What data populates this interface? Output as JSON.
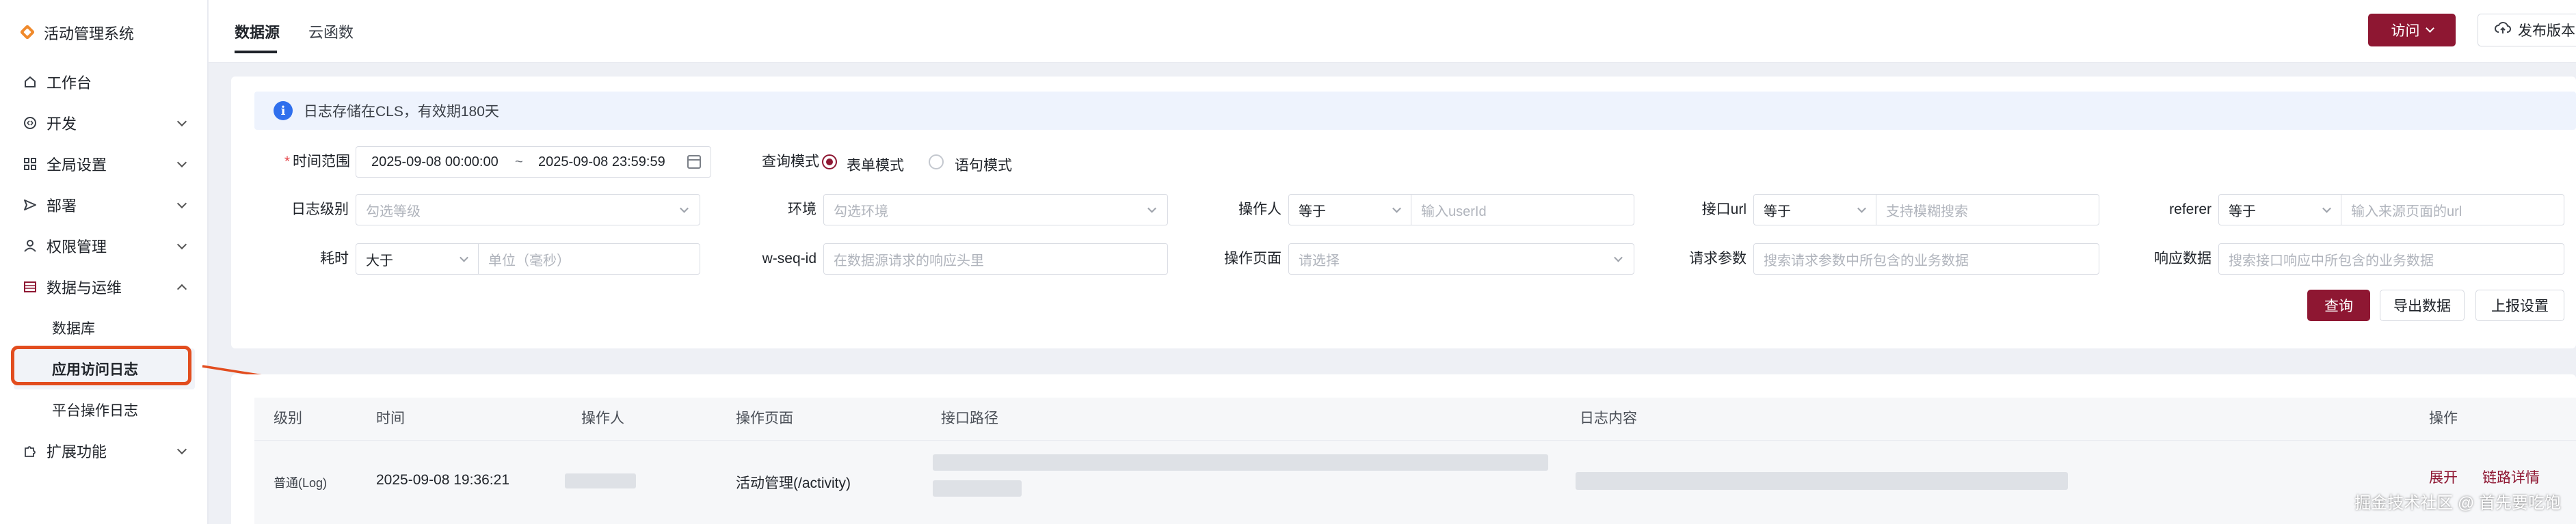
{
  "sidebar": {
    "app_title": "活动管理系统",
    "items": [
      {
        "label": "工作台",
        "icon": "home-icon"
      },
      {
        "label": "开发",
        "icon": "code-icon"
      },
      {
        "label": "全局设置",
        "icon": "grid-icon"
      },
      {
        "label": "部署",
        "icon": "send-icon"
      },
      {
        "label": "权限管理",
        "icon": "user-icon"
      },
      {
        "label": "数据与运维",
        "icon": "database-icon"
      },
      {
        "label": "扩展功能",
        "icon": "puzzle-icon"
      }
    ],
    "sub_items": [
      "数据库",
      "应用访问日志",
      "平台操作日志"
    ]
  },
  "topbar": {
    "tabs": [
      "数据源",
      "云函数"
    ],
    "visit_label": "访问",
    "publish_label": "发布版本"
  },
  "notice": {
    "text": "日志存储在CLS，有效期180天"
  },
  "filters": {
    "time_range_label": "时间范围",
    "time_start": "2025-09-08 00:00:00",
    "time_separator": "~",
    "time_end": "2025-09-08 23:59:59",
    "query_mode_label": "查询模式",
    "mode_form": "表单模式",
    "mode_statement": "语句模式",
    "log_level_label": "日志级别",
    "log_level_placeholder": "勾选等级",
    "env_label": "环境",
    "env_placeholder": "勾选环境",
    "operator_label": "操作人",
    "operator_op": "等于",
    "operator_placeholder": "输入userId",
    "api_url_label": "接口url",
    "api_url_op": "等于",
    "api_url_placeholder": "支持模糊搜索",
    "referer_label": "referer",
    "referer_op": "等于",
    "referer_placeholder": "输入来源页面的url",
    "duration_label": "耗时",
    "duration_op": "大于",
    "duration_placeholder": "单位（毫秒）",
    "wseq_label": "w-seq-id",
    "wseq_placeholder": "在数据源请求的响应头里",
    "page_label": "操作页面",
    "page_placeholder": "请选择",
    "req_params_label": "请求参数",
    "req_params_placeholder": "搜索请求参数中所包含的业务数据",
    "resp_label": "响应数据",
    "resp_placeholder": "搜索接口响应中所包含的业务数据"
  },
  "actions": {
    "query": "查询",
    "export": "导出数据",
    "report_settings": "上报设置"
  },
  "table": {
    "columns": [
      "级别",
      "时间",
      "操作人",
      "操作页面",
      "接口路径",
      "日志内容",
      "操作"
    ],
    "rows": [
      {
        "level": "普通(Log)",
        "time": "2025-09-08 19:36:21",
        "page": "活动管理(/activity)",
        "action_expand": "展开",
        "action_trace": "链路详情"
      }
    ]
  },
  "watermark": "掘金技术社区 @ 首先要吃饱",
  "colors": {
    "accent": "#8e1732",
    "highlight": "#e24d1f",
    "info": "#2f6fed"
  }
}
